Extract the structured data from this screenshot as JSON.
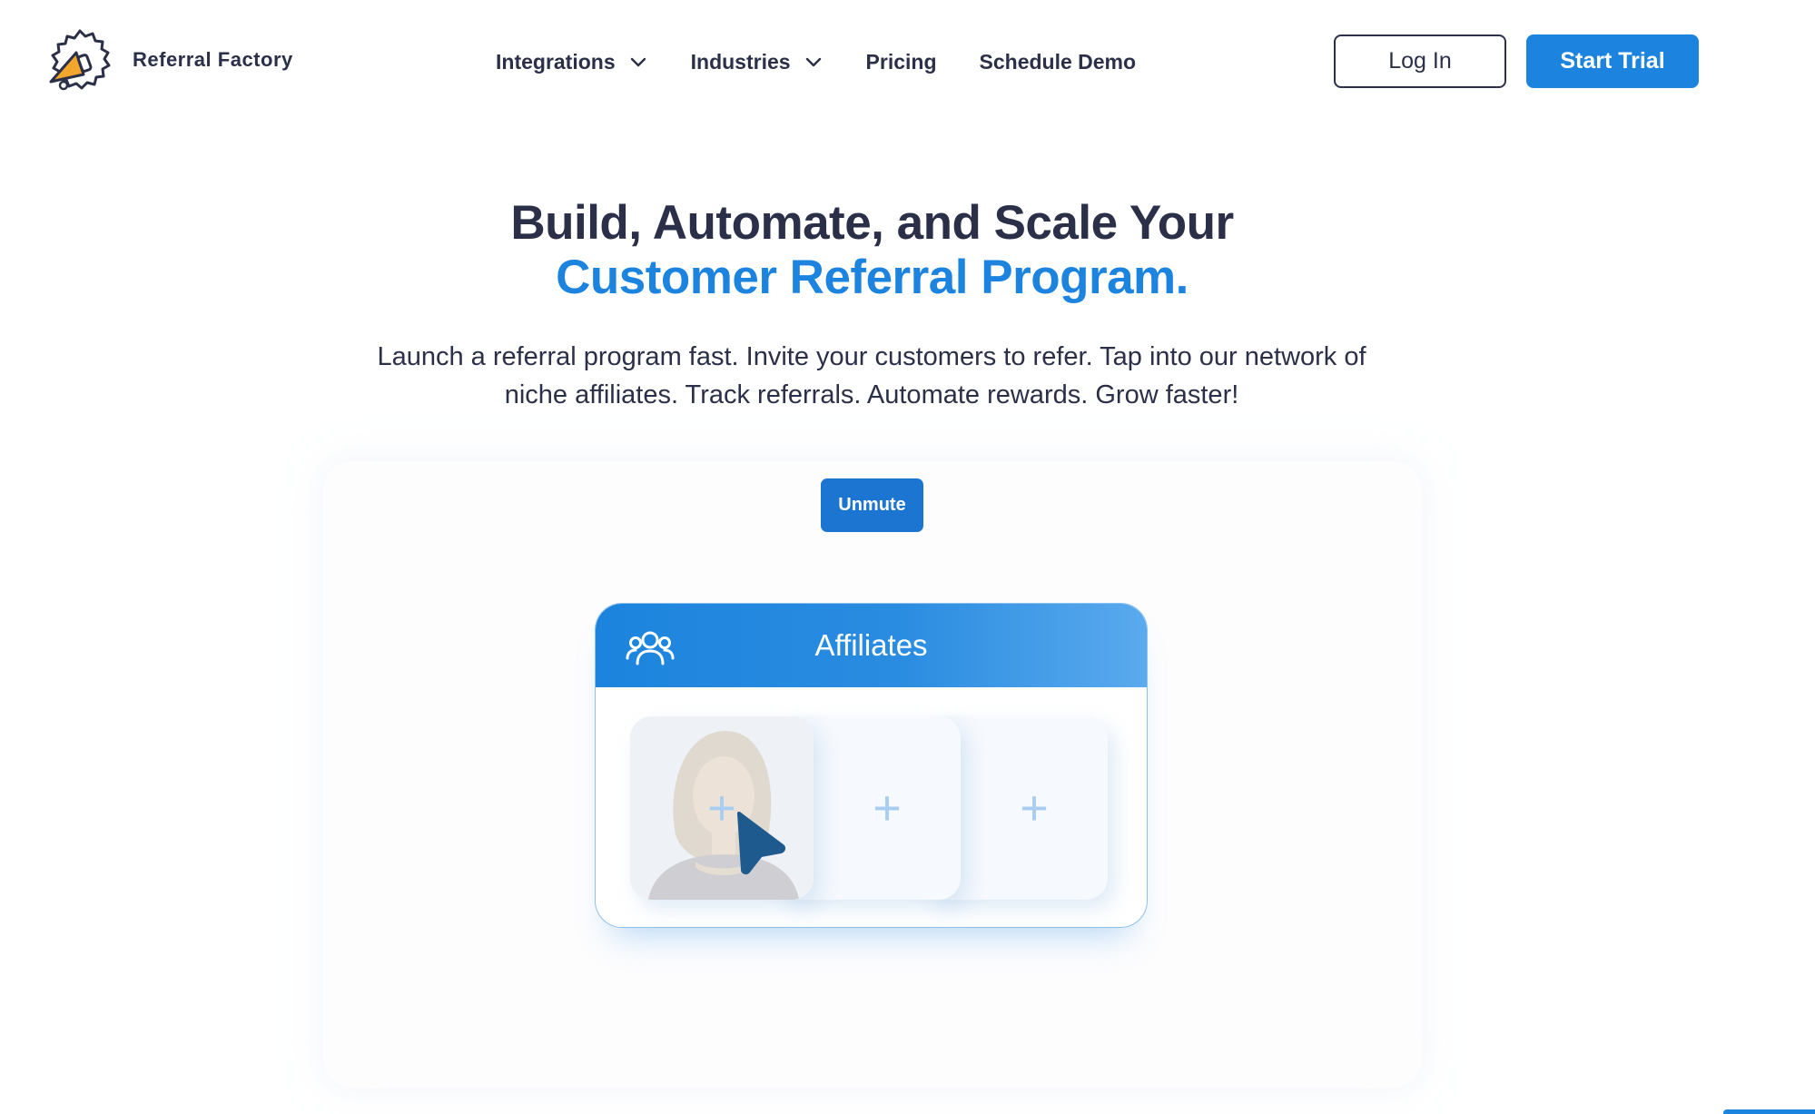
{
  "header": {
    "brand": "Referral Factory",
    "logo_icon": "gear-megaphone-icon",
    "nav": [
      {
        "label": "Integrations",
        "has_dropdown": true
      },
      {
        "label": "Industries",
        "has_dropdown": true
      },
      {
        "label": "Pricing",
        "has_dropdown": false
      },
      {
        "label": "Schedule Demo",
        "has_dropdown": false
      }
    ],
    "login_label": "Log In",
    "trial_label": "Start Trial"
  },
  "hero": {
    "title_line1": "Build, Automate, and Scale Your",
    "title_line2": "Customer Referral Program.",
    "subtitle": "Launch a referral program fast. Invite your customers to refer. Tap into our network of niche affiliates. Track referrals. Automate rewards. Grow faster!"
  },
  "video": {
    "unmute_label": "Unmute",
    "card_title": "Affiliates",
    "card_icon": "group-users-icon",
    "slot_glyph": "+",
    "cursor_icon": "pointer-cursor-icon"
  },
  "colors": {
    "text_dark": "#2b3048",
    "brand_blue": "#1c84de",
    "logo_orange": "#f2a62c"
  }
}
